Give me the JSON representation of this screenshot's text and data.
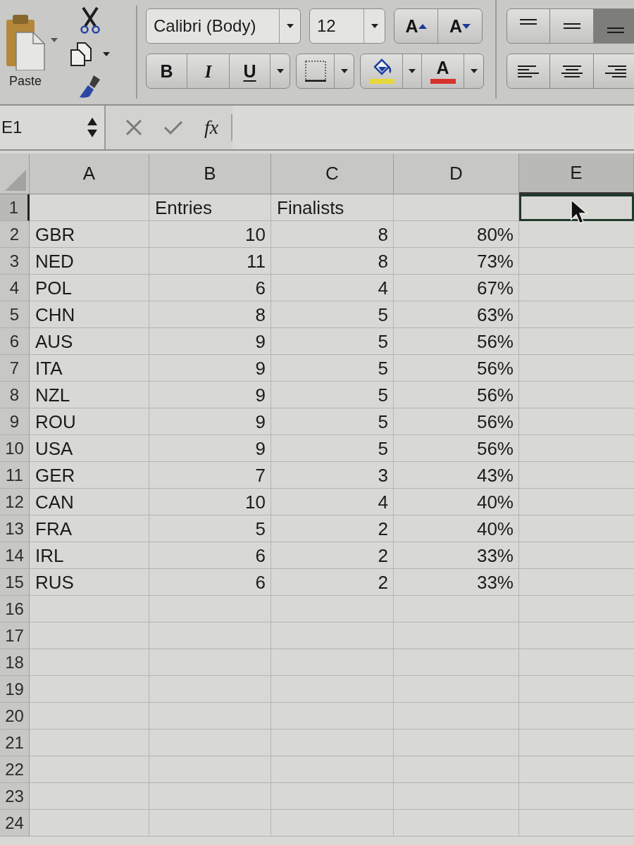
{
  "ribbon": {
    "paste": {
      "label": "Paste"
    },
    "font_name": {
      "value": "Calibri (Body)"
    },
    "font_size": {
      "value": "12"
    },
    "grow_font": {
      "label": "A"
    },
    "shrink_font": {
      "label": "A"
    },
    "bold": {
      "label": "B"
    },
    "italic": {
      "label": "I"
    },
    "underline": {
      "label": "U"
    },
    "fill_color": {
      "color": "#e6d83a"
    },
    "font_color": {
      "label": "A",
      "color": "#d6332b"
    },
    "vertical_align": [
      {
        "kind": "top",
        "selected": false
      },
      {
        "kind": "middle",
        "selected": false
      },
      {
        "kind": "bottom",
        "selected": true
      }
    ],
    "horizontal_align": [
      {
        "kind": "left",
        "selected": false
      },
      {
        "kind": "center",
        "selected": false
      },
      {
        "kind": "right",
        "selected": false
      }
    ]
  },
  "formula_bar": {
    "name_box": "E1",
    "function_label": "fx"
  },
  "sheet": {
    "columns": [
      {
        "label": "A",
        "selected": false
      },
      {
        "label": "B",
        "selected": false
      },
      {
        "label": "C",
        "selected": false
      },
      {
        "label": "D",
        "selected": false
      },
      {
        "label": "E",
        "selected": true
      }
    ],
    "rows": [
      {
        "label": "1",
        "selected": true,
        "cells": [
          null,
          "Entries",
          "Finalists"
        ]
      },
      {
        "label": "2",
        "selected": false,
        "cells": [
          "GBR",
          "10",
          "8",
          "80%"
        ]
      },
      {
        "label": "3",
        "selected": false,
        "cells": [
          "NED",
          "11",
          "8",
          "73%"
        ]
      },
      {
        "label": "4",
        "selected": false,
        "cells": [
          "POL",
          "6",
          "4",
          "67%"
        ]
      },
      {
        "label": "5",
        "selected": false,
        "cells": [
          "CHN",
          "8",
          "5",
          "63%"
        ]
      },
      {
        "label": "6",
        "selected": false,
        "cells": [
          "AUS",
          "9",
          "5",
          "56%"
        ]
      },
      {
        "label": "7",
        "selected": false,
        "cells": [
          "ITA",
          "9",
          "5",
          "56%"
        ]
      },
      {
        "label": "8",
        "selected": false,
        "cells": [
          "NZL",
          "9",
          "5",
          "56%"
        ]
      },
      {
        "label": "9",
        "selected": false,
        "cells": [
          "ROU",
          "9",
          "5",
          "56%"
        ]
      },
      {
        "label": "10",
        "selected": false,
        "cells": [
          "USA",
          "9",
          "5",
          "56%"
        ]
      },
      {
        "label": "11",
        "selected": false,
        "cells": [
          "GER",
          "7",
          "3",
          "43%"
        ]
      },
      {
        "label": "12",
        "selected": false,
        "cells": [
          "CAN",
          "10",
          "4",
          "40%"
        ]
      },
      {
        "label": "13",
        "selected": false,
        "cells": [
          "FRA",
          "5",
          "2",
          "40%"
        ]
      },
      {
        "label": "14",
        "selected": false,
        "cells": [
          "IRL",
          "6",
          "2",
          "33%"
        ]
      },
      {
        "label": "15",
        "selected": false,
        "cells": [
          "RUS",
          "6",
          "2",
          "33%"
        ]
      },
      {
        "label": "16",
        "selected": false
      },
      {
        "label": "17",
        "selected": false
      },
      {
        "label": "18",
        "selected": false
      },
      {
        "label": "19",
        "selected": false
      },
      {
        "label": "20",
        "selected": false
      },
      {
        "label": "21",
        "selected": false
      },
      {
        "label": "22",
        "selected": false
      },
      {
        "label": "23",
        "selected": false
      },
      {
        "label": "24",
        "selected": false
      }
    ]
  }
}
